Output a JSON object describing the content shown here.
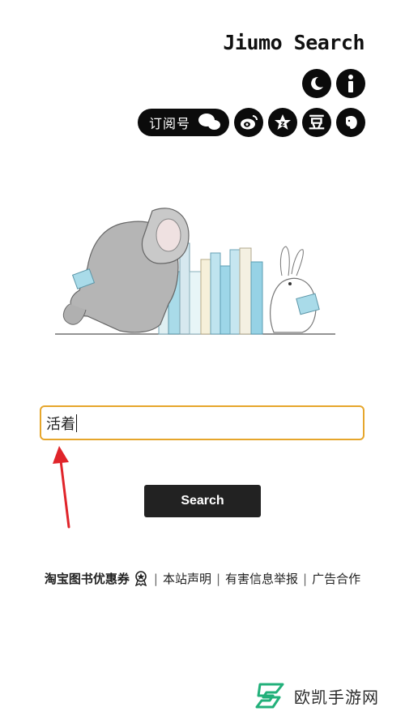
{
  "header": {
    "brand_title": "Jiumo Search"
  },
  "top_icons": [
    {
      "name": "moon-icon"
    },
    {
      "name": "info-icon"
    }
  ],
  "social": {
    "subscribe_label": "订阅号",
    "douban_label": "豆"
  },
  "search": {
    "value": "活着",
    "button_label": "Search"
  },
  "footer": {
    "coupon_label": "淘宝图书优惠券",
    "links": [
      "本站声明",
      "有害信息举报",
      "广告合作"
    ]
  },
  "watermark": {
    "text": "欧凯手游网"
  },
  "colors": {
    "accent_border": "#e6a62c",
    "annotation_arrow": "#e0242a",
    "button_bg": "#222222"
  }
}
